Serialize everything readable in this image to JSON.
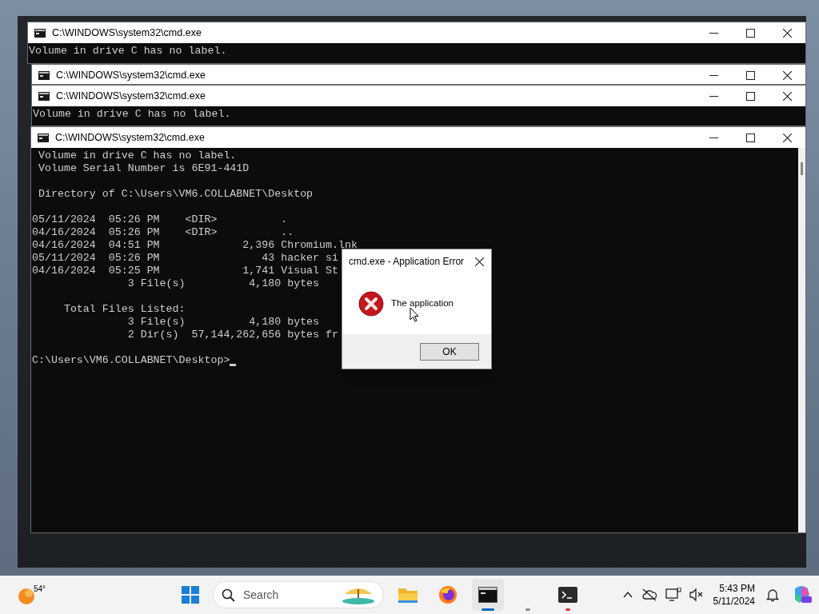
{
  "windows": [
    {
      "title": "C:\\WINDOWS\\system32\\cmd.exe",
      "lines": [
        "Volume in drive C has no label."
      ]
    },
    {
      "title": "C:\\WINDOWS\\system32\\cmd.exe"
    },
    {
      "title": "C:\\WINDOWS\\system32\\cmd.exe",
      "lines": [
        "Volume in drive C has no label."
      ]
    },
    {
      "title": "C:\\WINDOWS\\system32\\cmd.exe",
      "paragraphs": [
        [
          " Volume in drive C has no label.",
          " Volume Serial Number is 6E91-441D"
        ],
        [
          " Directory of C:\\Users\\VM6.COLLABNET\\Desktop"
        ],
        [
          "05/11/2024  05:26 PM    <DIR>          .",
          "04/16/2024  05:26 PM    <DIR>          ..",
          "04/16/2024  04:51 PM             2,396 Chromium.lnk",
          "05/11/2024  05:26 PM                43 hacker si",
          "04/16/2024  05:25 PM             1,741 Visual St",
          "               3 File(s)          4,180 bytes"
        ],
        [
          "     Total Files Listed:",
          "               3 File(s)          4,180 bytes",
          "               2 Dir(s)  57,144,262,656 bytes fr"
        ],
        [
          "C:\\Users\\VM6.COLLABNET\\Desktop>"
        ]
      ],
      "cursor": true
    }
  ],
  "dialog": {
    "title": "cmd.exe - Application Error",
    "message": "The application",
    "button": "OK"
  },
  "taskbar": {
    "weather": {
      "temperature": "54°"
    },
    "search": {
      "placeholder": "Search"
    },
    "apps": [
      {
        "kind": "files",
        "selected": false,
        "running": false,
        "attention": false
      },
      {
        "kind": "browser",
        "selected": false,
        "running": false,
        "attention": false
      },
      {
        "kind": "console",
        "selected": true,
        "running": true,
        "attention": false
      },
      {
        "kind": "blank",
        "selected": false,
        "running": true,
        "attention": false
      },
      {
        "kind": "terminal",
        "selected": false,
        "running": true,
        "attention": true
      }
    ],
    "clock": {
      "time": "5:43 PM",
      "date": "5/11/2024"
    }
  }
}
